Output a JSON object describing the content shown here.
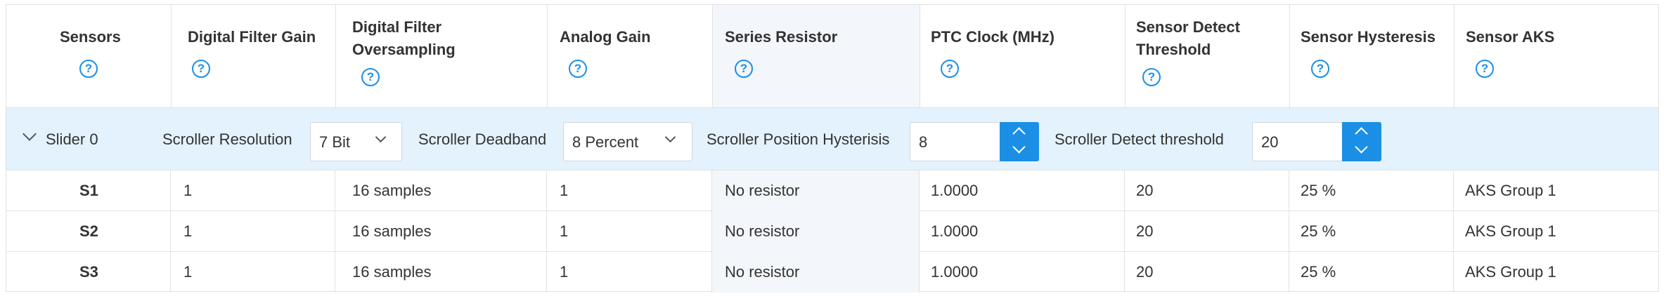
{
  "columns": [
    {
      "title": "Sensors"
    },
    {
      "title": "Digital Filter Gain"
    },
    {
      "title_line1": "Digital Filter",
      "title_line2": "Oversampling"
    },
    {
      "title": "Analog Gain"
    },
    {
      "title": "Series Resistor"
    },
    {
      "title": "PTC Clock (MHz)"
    },
    {
      "title_line1": "Sensor Detect",
      "title_line2": "Threshold"
    },
    {
      "title": "Sensor Hysteresis"
    },
    {
      "title": "Sensor AKS"
    }
  ],
  "help_icon_glyph": "?",
  "group": {
    "name": "Slider 0",
    "resolution_label": "Scroller Resolution",
    "resolution_value": "7 Bit",
    "deadband_label": "Scroller Deadband",
    "deadband_value": "8 Percent",
    "hysteresis_label": "Scroller Position Hysterisis",
    "hysteresis_value": "8",
    "threshold_label": "Scroller Detect threshold",
    "threshold_value": "20"
  },
  "rows": [
    {
      "sensor": "S1",
      "filter_gain": "1",
      "oversampling": "16 samples",
      "analog_gain": "1",
      "series_resistor": "No resistor",
      "ptc_clock": "1.0000",
      "detect_threshold": "20",
      "hysteresis": "25 %",
      "aks": "AKS Group 1"
    },
    {
      "sensor": "S2",
      "filter_gain": "1",
      "oversampling": "16 samples",
      "analog_gain": "1",
      "series_resistor": "No resistor",
      "ptc_clock": "1.0000",
      "detect_threshold": "20",
      "hysteresis": "25 %",
      "aks": "AKS Group 1"
    },
    {
      "sensor": "S3",
      "filter_gain": "1",
      "oversampling": "16 samples",
      "analog_gain": "1",
      "series_resistor": "No resistor",
      "ptc_clock": "1.0000",
      "detect_threshold": "20",
      "hysteresis": "25 %",
      "aks": "AKS Group 1"
    }
  ],
  "colors": {
    "accent": "#1b8fe6",
    "group_row_bg": "#e3f2fd",
    "highlight_col_bg": "#f3f6fa"
  }
}
